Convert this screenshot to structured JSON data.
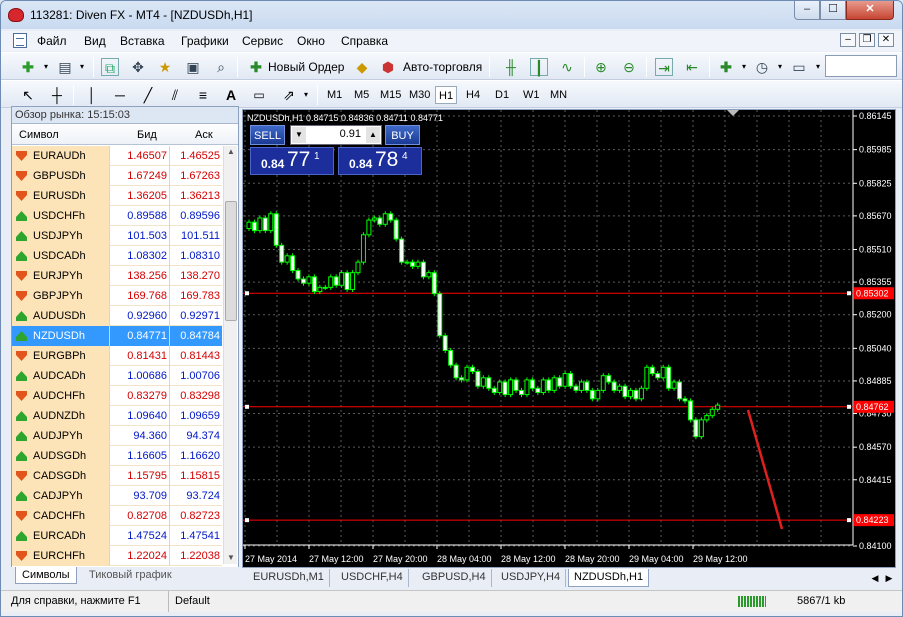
{
  "window": {
    "title": "113281: Diven FX - MT4 - [NZDUSDh,H1]",
    "min": "–",
    "max": "☐",
    "close": "✕"
  },
  "menu": [
    "Файл",
    "Вид",
    "Вставка",
    "Графики",
    "Сервис",
    "Окно",
    "Справка"
  ],
  "mdi": {
    "min": "–",
    "restore": "❐",
    "close": "✕"
  },
  "toolbar": {
    "new_order": "Новый Ордер",
    "auto_trading": "Авто-торговля"
  },
  "timeframes": [
    "M1",
    "M5",
    "M15",
    "M30",
    "H1",
    "H4",
    "D1",
    "W1",
    "MN"
  ],
  "market_watch": {
    "header": "Обзор рынка: 15:15:03",
    "col_symbol": "Символ",
    "col_bid": "Бид",
    "col_ask": "Аск",
    "rows": [
      {
        "symbol": "EURAUDh",
        "bid": "1.46507",
        "ask": "1.46525",
        "dir": "down"
      },
      {
        "symbol": "GBPUSDh",
        "bid": "1.67249",
        "ask": "1.67263",
        "dir": "down"
      },
      {
        "symbol": "EURUSDh",
        "bid": "1.36205",
        "ask": "1.36213",
        "dir": "down"
      },
      {
        "symbol": "USDCHFh",
        "bid": "0.89588",
        "ask": "0.89596",
        "dir": "up"
      },
      {
        "symbol": "USDJPYh",
        "bid": "101.503",
        "ask": "101.511",
        "dir": "up"
      },
      {
        "symbol": "USDCADh",
        "bid": "1.08302",
        "ask": "1.08310",
        "dir": "up"
      },
      {
        "symbol": "EURJPYh",
        "bid": "138.256",
        "ask": "138.270",
        "dir": "down"
      },
      {
        "symbol": "GBPJPYh",
        "bid": "169.768",
        "ask": "169.783",
        "dir": "down"
      },
      {
        "symbol": "AUDUSDh",
        "bid": "0.92960",
        "ask": "0.92971",
        "dir": "up"
      },
      {
        "symbol": "NZDUSDh",
        "bid": "0.84771",
        "ask": "0.84784",
        "dir": "up",
        "selected": true
      },
      {
        "symbol": "EURGBPh",
        "bid": "0.81431",
        "ask": "0.81443",
        "dir": "down"
      },
      {
        "symbol": "AUDCADh",
        "bid": "1.00686",
        "ask": "1.00706",
        "dir": "up"
      },
      {
        "symbol": "AUDCHFh",
        "bid": "0.83279",
        "ask": "0.83298",
        "dir": "down"
      },
      {
        "symbol": "AUDNZDh",
        "bid": "1.09640",
        "ask": "1.09659",
        "dir": "up"
      },
      {
        "symbol": "AUDJPYh",
        "bid": "94.360",
        "ask": "94.374",
        "dir": "up"
      },
      {
        "symbol": "AUDSGDh",
        "bid": "1.16605",
        "ask": "1.16620",
        "dir": "up"
      },
      {
        "symbol": "CADSGDh",
        "bid": "1.15795",
        "ask": "1.15815",
        "dir": "down"
      },
      {
        "symbol": "CADJPYh",
        "bid": "93.709",
        "ask": "93.724",
        "dir": "up"
      },
      {
        "symbol": "CADCHFh",
        "bid": "0.82708",
        "ask": "0.82723",
        "dir": "down"
      },
      {
        "symbol": "EURCADh",
        "bid": "1.47524",
        "ask": "1.47541",
        "dir": "up"
      },
      {
        "symbol": "EURCHFh",
        "bid": "1.22024",
        "ask": "1.22038",
        "dir": "down"
      }
    ],
    "tabs": [
      "Символы",
      "Тиковый график"
    ]
  },
  "chart": {
    "info": "NZDUSDh,H1  0.84715 0.84836 0.84711 0.84771",
    "sell_label": "SELL",
    "buy_label": "BUY",
    "volume": "0.91",
    "sell_price": {
      "big": "0.84",
      "pips": "77",
      "frac": "1"
    },
    "buy_price": {
      "big": "0.84",
      "pips": "78",
      "frac": "4"
    },
    "price_labels": [
      "0.86145",
      "0.85985",
      "0.85825",
      "0.85670",
      "0.85510",
      "0.85355",
      "0.85200",
      "0.85040",
      "0.84885",
      "0.84730",
      "0.84570",
      "0.84415",
      "0.84100"
    ],
    "hlines": [
      "0.85302",
      "0.84762",
      "0.84223"
    ],
    "time_labels": [
      "27 May 2014",
      "27 May 12:00",
      "27 May 20:00",
      "28 May 04:00",
      "28 May 12:00",
      "28 May 20:00",
      "29 May 04:00",
      "29 May 12:00"
    ],
    "colors": {
      "bg": "#000000",
      "grid": "#5a5a5a",
      "candle": "#00ff00",
      "line": "#ff0000",
      "trend": "#e02020"
    }
  },
  "chart_tabs": [
    "EURUSDh,M1",
    "USDCHF,H4",
    "GBPUSD,H4",
    "USDJPY,H4",
    "NZDUSDh,H1"
  ],
  "status": {
    "help": "Для справки, нажмите F1",
    "profile": "Default",
    "traffic": "5867/1 kb"
  }
}
